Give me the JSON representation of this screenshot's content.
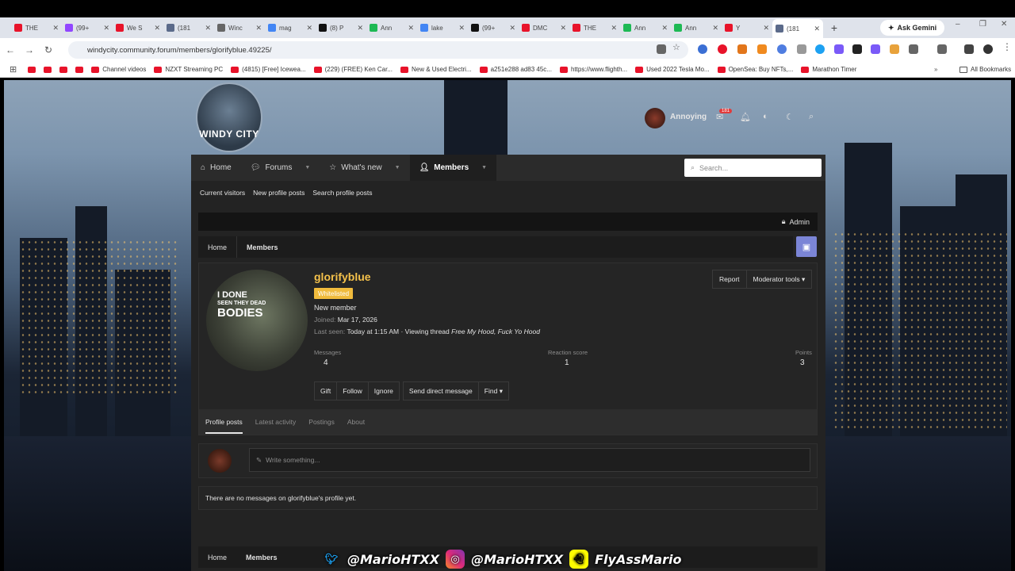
{
  "browser": {
    "tabs": [
      {
        "label": "THE",
        "color": "#e8132a"
      },
      {
        "label": "(99+",
        "color": "#9146ff"
      },
      {
        "label": "We S",
        "color": "#e8132a"
      },
      {
        "label": "(181",
        "color": "#5b6a8a"
      },
      {
        "label": "Winc",
        "color": "#666666"
      },
      {
        "label": "mag",
        "color": "#4285f4"
      },
      {
        "label": "(8) P",
        "color": "#111111"
      },
      {
        "label": "Ann",
        "color": "#1db954"
      },
      {
        "label": "lake",
        "color": "#4285f4"
      },
      {
        "label": "(99+",
        "color": "#111111"
      },
      {
        "label": "DMC",
        "color": "#e8132a"
      },
      {
        "label": "THE",
        "color": "#e8132a"
      },
      {
        "label": "Ann",
        "color": "#1db954"
      },
      {
        "label": "Ann",
        "color": "#1db954"
      },
      {
        "label": "Y",
        "color": "#e8132a"
      },
      {
        "label": "(181",
        "color": "#5b6a8a"
      }
    ],
    "ask_gemini": "Ask Gemini",
    "url": "windycity.community.forum/members/glorifyblue.49225/",
    "bookmarks": [
      "Channel videos",
      "NZXT Streaming PC",
      "(4815) [Free] Icewea...",
      "(229) (FREE) Ken Car...",
      "New & Used Electri...",
      "a251e288 ad83 45c...",
      "https://www.flighth...",
      "Used 2022 Tesla Mo...",
      "OpenSea: Buy NFTs,...",
      "Marathon Timer"
    ],
    "all_bookmarks": "All Bookmarks"
  },
  "site": {
    "logo_text": "WINDY CITY",
    "user": "Annoying",
    "inbox_count": "181",
    "nav": {
      "home": "Home",
      "forums": "Forums",
      "whats_new": "What's new",
      "members": "Members"
    },
    "search_placeholder": "Search...",
    "subnav": [
      "Current visitors",
      "New profile posts",
      "Search profile posts"
    ],
    "admin": "Admin",
    "breadcrumb": [
      "Home",
      "Members"
    ]
  },
  "profile": {
    "avatar_text": {
      "line1": "I DONE",
      "line2": "SEEN THEY DEAD",
      "line3": "BODIES"
    },
    "name": "glorifyblue",
    "badge": "Whitelisted",
    "title": "New member",
    "joined_label": "Joined:",
    "joined": "Mar 17, 2026",
    "last_seen_label": "Last seen:",
    "last_seen": "Today at 1:15 AM · Viewing thread",
    "last_seen_thread": "Free My Hood, Fuck Yo Hood",
    "report": "Report",
    "moderator_tools": "Moderator tools",
    "stats": {
      "messages_label": "Messages",
      "messages": "4",
      "reaction_label": "Reaction score",
      "reaction": "1",
      "points_label": "Points",
      "points": "3"
    },
    "actions": {
      "gift": "Gift",
      "follow": "Follow",
      "ignore": "Ignore",
      "dm": "Send direct message",
      "find": "Find"
    },
    "tabs": [
      "Profile posts",
      "Latest activity",
      "Postings",
      "About"
    ]
  },
  "composer_placeholder": "Write something...",
  "no_messages": "There are no messages on glorifyblue's profile yet.",
  "socials": {
    "twitter": "@MarioHTXX",
    "instagram": "@MarioHTXX",
    "snapchat": "FlyAssMario"
  }
}
